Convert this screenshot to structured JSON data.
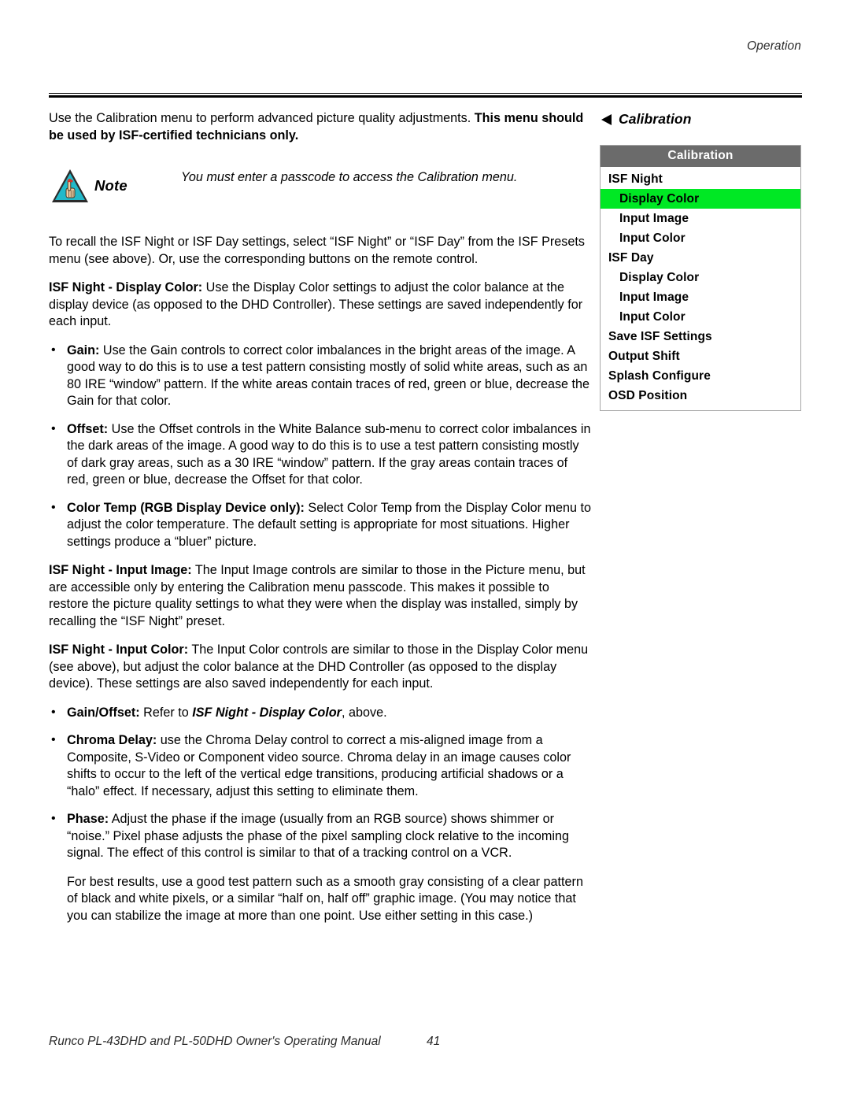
{
  "header": {
    "running_head": "Operation"
  },
  "intro": {
    "normal_1": "Use the Calibration menu to perform advanced picture quality adjustments. ",
    "bold_1": "This menu should be used by ISF-certified technicians only."
  },
  "note": {
    "icon": "note-hand-triangle-icon",
    "label": "Note",
    "text": "You must enter a passcode to access the Calibration menu."
  },
  "paragraphs": {
    "recall": "To recall the ISF Night or ISF Day settings, select “ISF Night” or “ISF Day” from the ISF Presets menu (see above). Or, use the corresponding buttons on the remote control.",
    "display_color_head": "ISF Night - Display Color:",
    "display_color_body": " Use the Display Color settings to adjust the color balance at the display device (as opposed to the DHD Controller). These settings are saved independently for each input.",
    "input_image_head": "ISF Night - Input Image:",
    "input_image_body": " The Input Image controls are similar to those in the Picture menu, but are accessible only by entering the Calibration menu passcode. This makes it possible to restore the picture quality settings to what they were when the display was installed, simply by recalling the “ISF Night” preset.",
    "input_color_head": "ISF Night - Input Color:",
    "input_color_body": " The Input Color controls are similar to those in the Display Color menu (see above), but adjust the color balance at the DHD Controller (as opposed to the display device). These settings are also saved independently for each input.",
    "best_results": "For best results, use a good test pattern such as a smooth gray consisting of a clear pattern of black and white pixels, or a similar “half on, half off” graphic image. (You may notice that you can stabilize the image at more than one point. Use either setting in this case.)"
  },
  "bullets_display_color": [
    {
      "head": "Gain:",
      "body": " Use the Gain controls to correct color imbalances in the bright areas of the image. A good way to do this is to use a test pattern consisting mostly of solid white areas, such as an 80 IRE “window” pattern. If the white areas contain traces of red, green or blue, decrease the Gain for that color."
    },
    {
      "head": "Offset:",
      "body": " Use the Offset controls in the White Balance sub-menu to correct color imbalances in the dark areas of the image. A good way to do this is to use a test pattern consisting mostly of dark gray areas, such as a 30 IRE “window” pattern. If the gray areas contain traces of red, green or blue, decrease the Offset for that color."
    },
    {
      "head": "Color Temp (RGB Display Device only):",
      "body": " Select Color Temp from the Display Color menu to adjust the color temperature. The default setting is appropriate for most situations. Higher settings produce a “bluer” picture."
    }
  ],
  "bullets_input_color": [
    {
      "head": "Gain/Offset:",
      "mid": " Refer to ",
      "emph": "ISF Night - Display Color",
      "tail": ", above."
    },
    {
      "head": "Chroma Delay:",
      "body": " use the Chroma Delay control to correct a mis-aligned image from a Composite, S-Video or Component video source. Chroma delay in an image causes color shifts to occur to the left of the vertical edge transitions, producing artificial shadows or a “halo” effect. If necessary, adjust this setting to eliminate them."
    },
    {
      "head": "Phase:",
      "body": " Adjust the phase if the image (usually from an RGB source) shows shimmer or “noise.” Pixel phase adjusts the phase of the pixel sampling clock relative to the incoming signal. The effect of this control is similar to that of a tracking control on a VCR."
    }
  ],
  "figure": {
    "caption": "Calibration",
    "pointer_icon": "triangle-left-icon",
    "menu": {
      "title": "Calibration",
      "selected_color": "#00e824",
      "title_bg": "#6b6b6b",
      "items": [
        {
          "label": "ISF Night",
          "indent": false,
          "selected": false
        },
        {
          "label": "Display Color",
          "indent": true,
          "selected": true
        },
        {
          "label": "Input Image",
          "indent": true,
          "selected": false
        },
        {
          "label": "Input Color",
          "indent": true,
          "selected": false
        },
        {
          "label": "ISF Day",
          "indent": false,
          "selected": false
        },
        {
          "label": "Display Color",
          "indent": true,
          "selected": false
        },
        {
          "label": "Input Image",
          "indent": true,
          "selected": false
        },
        {
          "label": "Input Color",
          "indent": true,
          "selected": false
        },
        {
          "label": "Save ISF Settings",
          "indent": false,
          "selected": false
        },
        {
          "label": "Output Shift",
          "indent": false,
          "selected": false
        },
        {
          "label": "Splash Configure",
          "indent": false,
          "selected": false
        },
        {
          "label": "OSD Position",
          "indent": false,
          "selected": false
        }
      ]
    }
  },
  "footer": {
    "title": "Runco PL-43DHD and PL-50DHD Owner's Operating Manual",
    "page": "41"
  }
}
